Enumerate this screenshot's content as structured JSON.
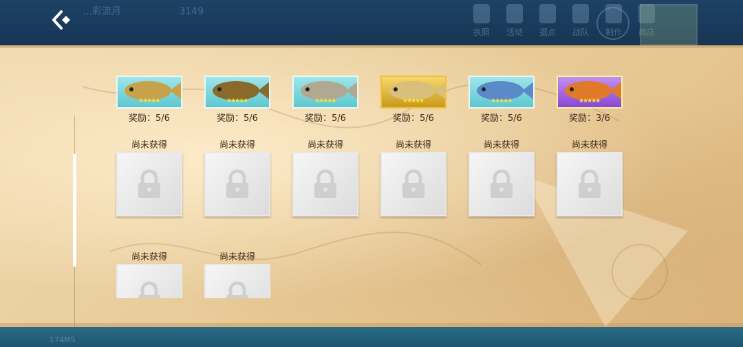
{
  "header": {
    "faded_title": "…彩流月",
    "faded_counter": "3149",
    "nav": [
      "执照",
      "活动",
      "据点",
      "战队",
      "制作",
      "商店"
    ]
  },
  "footer": {
    "ping": "174MS"
  },
  "rewards": [
    {
      "label": "奖励：5/6",
      "style": "teal",
      "fish_color": "#c8a24a"
    },
    {
      "label": "奖励：5/6",
      "style": "teal",
      "fish_color": "#8a6a2a"
    },
    {
      "label": "奖励：5/6",
      "style": "teal",
      "fish_color": "#b0a890"
    },
    {
      "label": "奖励：5/6",
      "style": "gold",
      "fish_color": "#d8c07a"
    },
    {
      "label": "奖励：5/6",
      "style": "teal",
      "fish_color": "#5a8ac8"
    },
    {
      "label": "奖励：3/6",
      "style": "purple",
      "fish_color": "#e07a2a"
    }
  ],
  "locked_label": "尚未获得",
  "locked_rows": [
    6,
    2
  ]
}
